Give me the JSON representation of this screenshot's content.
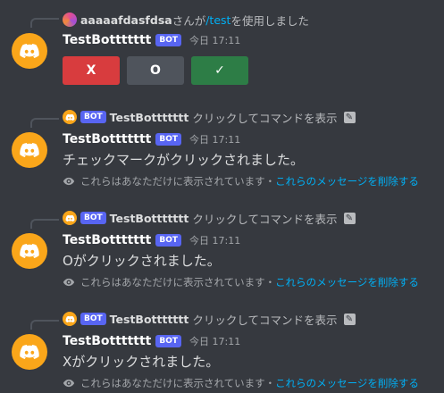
{
  "colors": {
    "background": "#36393f",
    "bot_avatar": "#faa61a",
    "bot_badge": "#5865f2",
    "link": "#00aff4",
    "button_danger": "#d83c3e",
    "button_secondary": "#4f545c",
    "button_success": "#2d7d46"
  },
  "first_message": {
    "reference": {
      "user": "aaaaafdasfdsa",
      "text_before": "さんが",
      "command": "/test",
      "text_after": "を使用しました"
    },
    "author": "TestBottttttt",
    "badge": "BOT",
    "timestamp": "今日 17:11",
    "buttons": [
      {
        "label": "X",
        "style": "danger"
      },
      {
        "label": "O",
        "style": "secondary"
      },
      {
        "label": "✓",
        "style": "success"
      }
    ]
  },
  "messages": [
    {
      "reference": {
        "badge": "BOT",
        "bot_name": "TestBottttttt",
        "text": "クリックしてコマンドを表示",
        "icon": "edit-icon"
      },
      "author": "TestBottttttt",
      "badge": "BOT",
      "timestamp": "今日 17:11",
      "content": "チェックマークがクリックされました。",
      "ephemeral_note": "これらはあなただけに表示されています・",
      "ephemeral_link": "これらのメッセージを削除する"
    },
    {
      "reference": {
        "badge": "BOT",
        "bot_name": "TestBottttttt",
        "text": "クリックしてコマンドを表示",
        "icon": "edit-icon"
      },
      "author": "TestBottttttt",
      "badge": "BOT",
      "timestamp": "今日 17:11",
      "content": "Oがクリックされました。",
      "ephemeral_note": "これらはあなただけに表示されています・",
      "ephemeral_link": "これらのメッセージを削除する"
    },
    {
      "reference": {
        "badge": "BOT",
        "bot_name": "TestBottttttt",
        "text": "クリックしてコマンドを表示",
        "icon": "edit-icon"
      },
      "author": "TestBottttttt",
      "badge": "BOT",
      "timestamp": "今日 17:11",
      "content": "Xがクリックされました。",
      "ephemeral_note": "これらはあなただけに表示されています・",
      "ephemeral_link": "これらのメッセージを削除する"
    }
  ]
}
